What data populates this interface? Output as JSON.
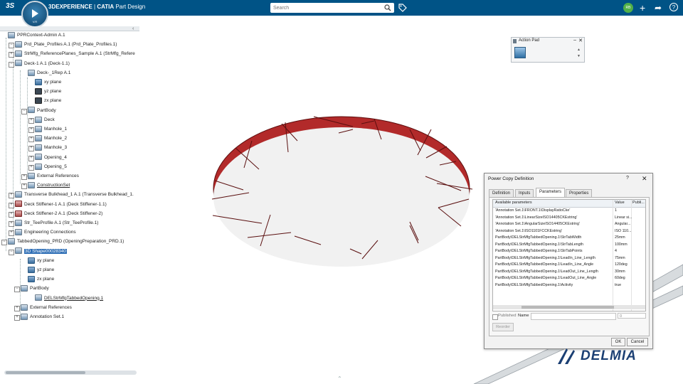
{
  "topbar": {
    "brand_main": "3DEXPERIENCE",
    "brand_sep": " | ",
    "brand_app": "CATIA",
    "brand_module": " Part Design",
    "compass_version": "V.R",
    "search_placeholder": "Search",
    "user_initials": "RB"
  },
  "tree": {
    "items": [
      {
        "label": "PPRContext-Admin A.1"
      },
      {
        "label": "Prd_Plate_Profiles A.1 (Prd_Plate_Profiles.1)"
      },
      {
        "label": "StrMfg_ReferencePlanes_Sample A.1 (StrMfg_Refere"
      },
      {
        "label": "Deck-1 A.1 (Deck-1.1)"
      },
      {
        "label": "Deck-_1Rep A.1"
      },
      {
        "label": "xy plane"
      },
      {
        "label": "yz plane"
      },
      {
        "label": "zx plane"
      },
      {
        "label": "PartBody"
      },
      {
        "label": "Deck"
      },
      {
        "label": "Manhole_1"
      },
      {
        "label": "Manhole_2"
      },
      {
        "label": "Manhole_3"
      },
      {
        "label": "Opening_4"
      },
      {
        "label": "Opening_5"
      },
      {
        "label": "External References"
      },
      {
        "label": "ConstructionSet"
      },
      {
        "label": "Transverse Bulkhead_1 A.1 (Transverse Bulkhead_1."
      },
      {
        "label": "Deck Stiffener-1 A.1 (Deck Stiffener-1.1)"
      },
      {
        "label": "Deck Stiffener-2 A.1 (Deck Stiffener-2)"
      },
      {
        "label": "Str_TeeProfile A.1 (Str_TeeProfile.1)"
      },
      {
        "label": "Engineering Connections"
      },
      {
        "label": "TabbedOpening_PRD (OpeningPreparation_PRD.1)"
      },
      {
        "label": "3D Shape00028340"
      },
      {
        "label": "xy plane"
      },
      {
        "label": "yz plane"
      },
      {
        "label": "zx plane"
      },
      {
        "label": "PartBody"
      },
      {
        "label": "DELStrMfgTabbedOpening.1"
      },
      {
        "label": "External References"
      },
      {
        "label": "Annotation Set.1"
      }
    ]
  },
  "action_pad": {
    "title": "Action Pad"
  },
  "dialog": {
    "title": "Power Copy Definition",
    "help": "?",
    "close": "✕",
    "tabs": [
      "Definition",
      "Inputs",
      "Parameters",
      "Properties"
    ],
    "active_tab": "Parameters",
    "grid_headers": [
      "Available parameters",
      "Value",
      "Publi..."
    ],
    "rows": [
      {
        "name": "'Annotation Set.1\\FRONT.1\\DisplayRatioCke'",
        "value": "1"
      },
      {
        "name": "'Annotation Set.1\\LinearSizeISO14405CKEstring'",
        "value": "Linear si..."
      },
      {
        "name": "'Annotation Set.1\\AngularSizeISO14405CKEstring'",
        "value": "Angular..."
      },
      {
        "name": "'Annotation Set.1\\ISO1101FCCKEstring'",
        "value": "ISO 110..."
      },
      {
        "name": "PartBody\\DELStrMfgTabbedOpening.1\\StrTabWidth",
        "value": "25mm"
      },
      {
        "name": "PartBody\\DELStrMfgTabbedOpening.1\\StrTabLength",
        "value": "100mm"
      },
      {
        "name": "PartBody\\DELStrMfgTabbedOpening.1\\StrTabPoints",
        "value": "4"
      },
      {
        "name": "PartBody\\DELStrMfgTabbedOpening.1\\LeadIn_Line_Length",
        "value": "75mm"
      },
      {
        "name": "PartBody\\DELStrMfgTabbedOpening.1\\LeadIn_Line_Angle",
        "value": "120deg"
      },
      {
        "name": "PartBody\\DELStrMfgTabbedOpening.1\\LeadOut_Line_Length",
        "value": "30mm"
      },
      {
        "name": "PartBody\\DELStrMfgTabbedOpening.1\\LeadOut_Line_Angle",
        "value": "60deg"
      },
      {
        "name": "PartBody\\DELStrMfgTabbedOpening.1\\Activity",
        "value": "true"
      }
    ],
    "published_label": "Published",
    "name_label": "Name",
    "number_value": "0",
    "reorder_label": "Reorder",
    "ok_label": "OK",
    "cancel_label": "Cancel"
  },
  "watermark": {
    "text": "DELMIA"
  },
  "colors": {
    "topbar": "#005386",
    "ring_outer": "#b12a2a",
    "ring_inner": "#7d1515",
    "selection": "#2f6fb6"
  }
}
